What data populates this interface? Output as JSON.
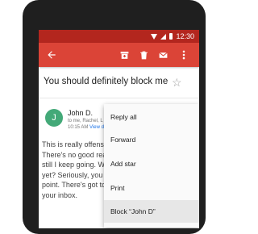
{
  "status_bar": {
    "time": "12:30"
  },
  "toolbar": {
    "icons": [
      "back-arrow-icon",
      "archive-icon",
      "delete-icon",
      "mark-unread-icon",
      "more-vert-icon"
    ]
  },
  "email": {
    "subject": "You should definitely block me",
    "sender_initial": "J",
    "sender_name": "John D.",
    "recipients": "to me, Rachel, L",
    "time": "10:15 AM",
    "view_link": "View d",
    "body_lines": [
      "This is really offensiv",
      "There's no good reas",
      "still I keep going. Wh",
      "yet? Seriously, you sh",
      "point. There's got to",
      "your inbox."
    ]
  },
  "menu": {
    "items": [
      "Reply all",
      "Forward",
      "Add star",
      "Print",
      "Block “John D”"
    ],
    "selected_index": 4
  },
  "colors": {
    "status_bar": "#b3261e",
    "toolbar": "#db4437",
    "avatar": "#43a978"
  }
}
